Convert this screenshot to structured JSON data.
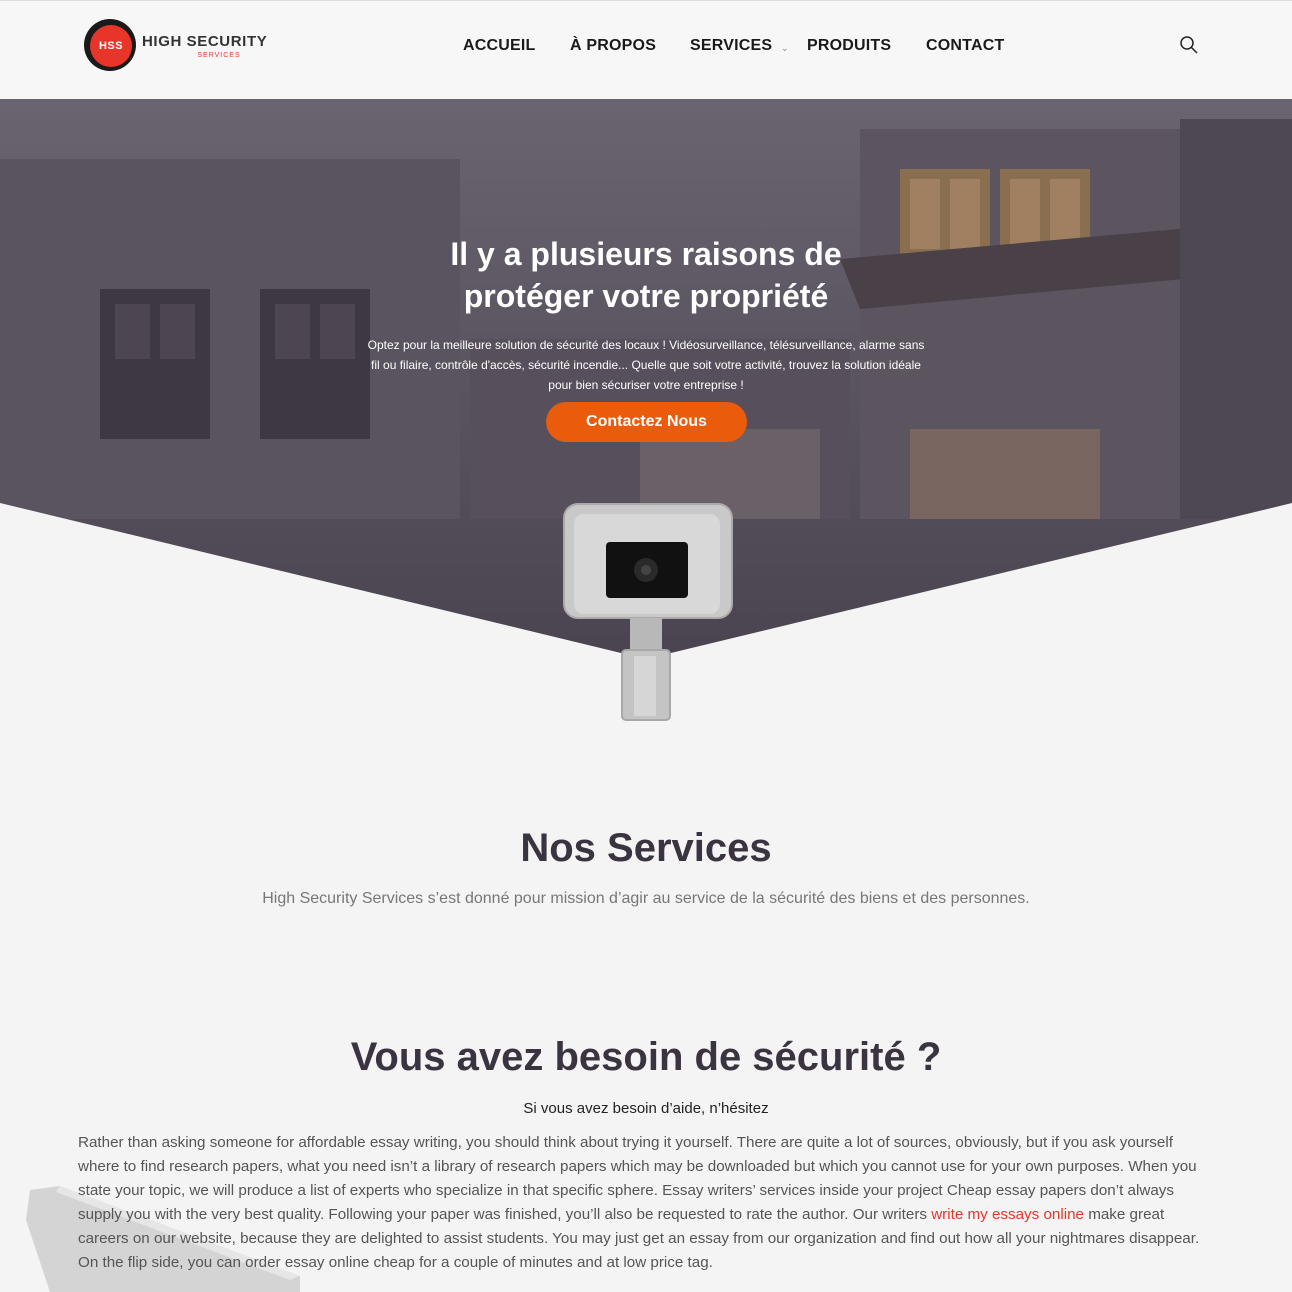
{
  "header": {
    "logo_badge": "HSS",
    "logo_title": "HIGH SECURITY",
    "logo_subtitle": "SERVICES",
    "nav": [
      {
        "label": "ACCUEIL"
      },
      {
        "label": "À PROPOS"
      },
      {
        "label": "SERVICES"
      },
      {
        "label": "PRODUITS"
      },
      {
        "label": "CONTACT"
      }
    ],
    "search_icon": "search-icon",
    "dropdown_icon": "chevron-down-icon"
  },
  "hero": {
    "title_line1": "Il y a plusieurs raisons de",
    "title_line2": "protéger votre propriété",
    "text_line1": "Optez pour la meilleure solution de sécurité des locaux ! Vidéosurveillance, télésurveillance, alarme sans",
    "text_line2": "fil ou filaire, contrôle d'accès, sécurité incendie... Quelle que soit votre activité, trouvez la solution idéale",
    "text_line3": "pour bien sécuriser votre entreprise !",
    "button_label": "Contactez Nous"
  },
  "services": {
    "title": "Nos Services",
    "text": "High Security Services s’est donné pour mission d’agir au service de la sécurité des biens et des personnes."
  },
  "need": {
    "title": "Vous avez besoin de sécurité ?",
    "subtitle": "Si vous avez besoin d’aide, n’hésitez",
    "para_before": "Rather than asking someone for affordable essay writing, you should think about trying it yourself. There are quite a lot of sources, obviously, but if you ask yourself where to find research papers, what you need isn’t a library of research papers which may be downloaded but which you cannot use for your own purposes. When you state your topic, we will produce a list of experts who specialize in that specific sphere. Essay writers’ services inside your project Cheap essay papers don’t always supply you with the very best quality. Following your paper was finished, you’ll also be requested to rate the author. Our writers ",
    "link": "write my essays online",
    "para_after": " make great careers on our website, because they are delighted to assist students. You may just get an essay from our organization and find out how all your nightmares disappear. On the flip side, you can order essay online cheap for a couple of minutes and at low price tag."
  },
  "colors": {
    "accent": "#ea5b0c",
    "brand_red": "#e8352a",
    "heading": "#3a3440"
  }
}
